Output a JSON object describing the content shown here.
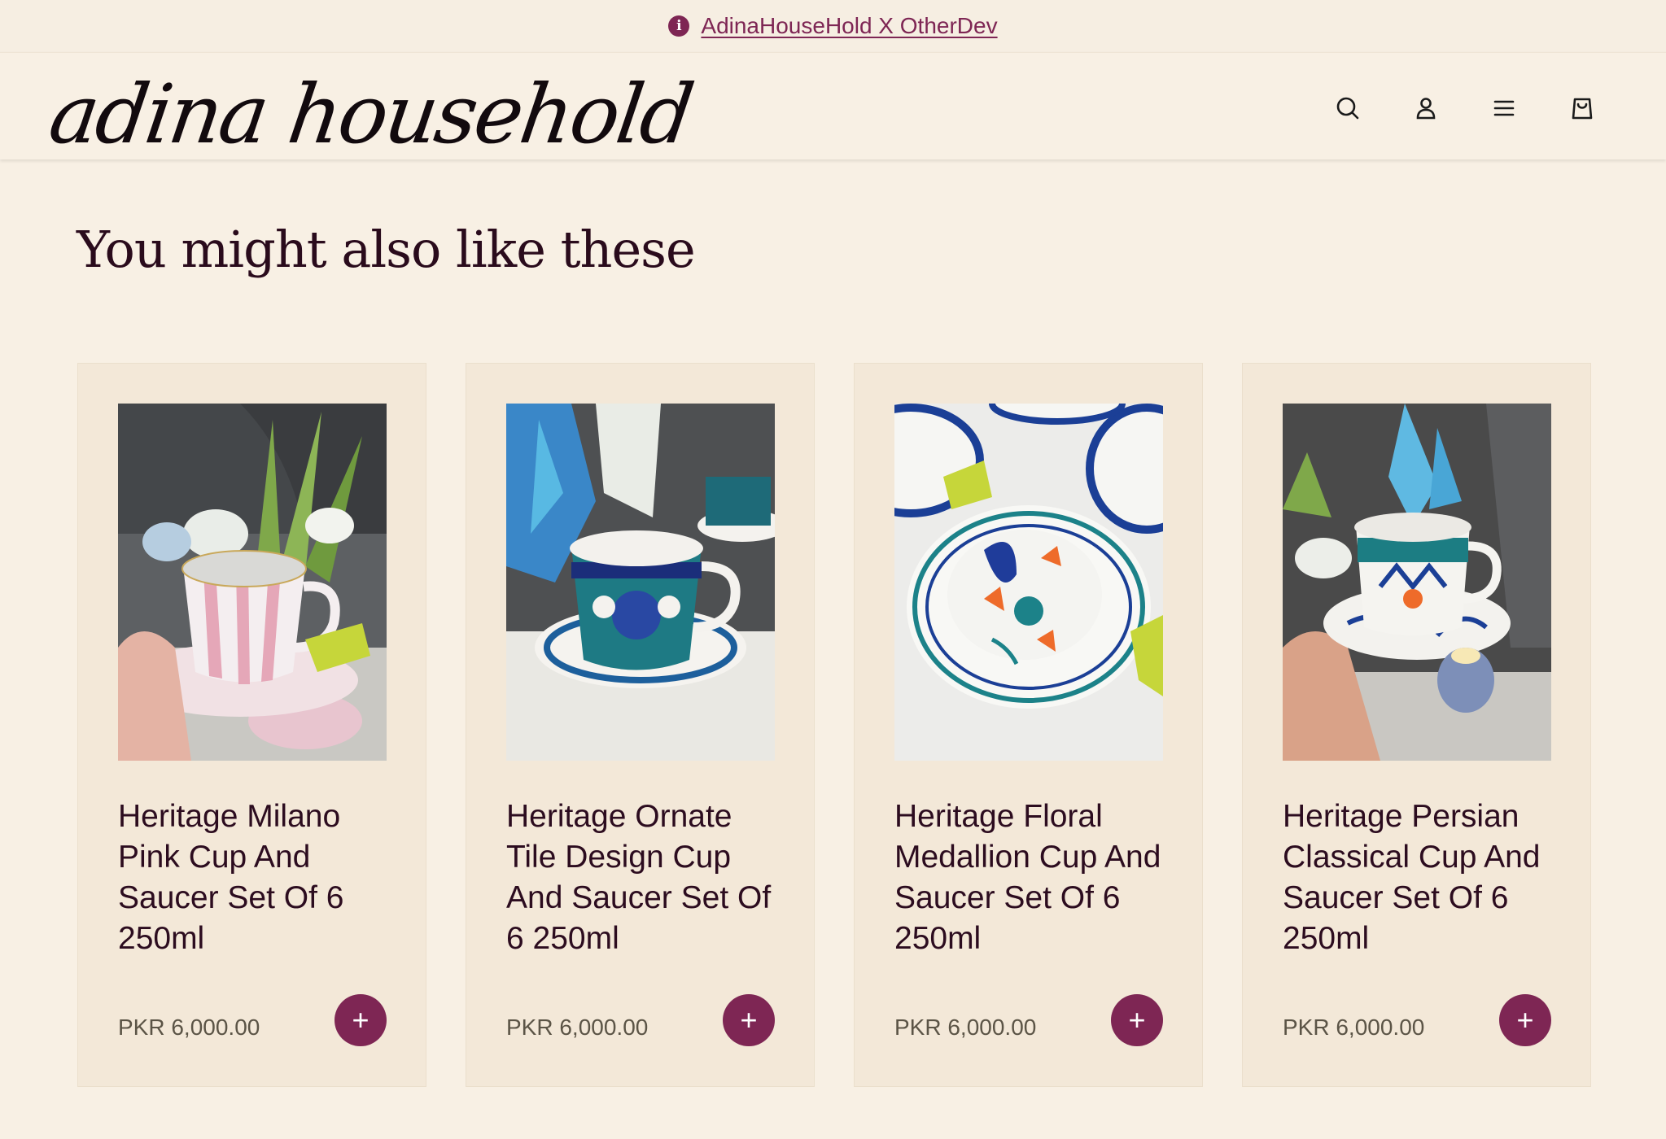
{
  "announcement": {
    "text": "AdinaHouseHold X OtherDev"
  },
  "header": {
    "logo_text": "adina household",
    "icons": [
      "search-icon",
      "account-icon",
      "menu-icon",
      "cart-icon"
    ]
  },
  "section": {
    "title": "You might also like these"
  },
  "products": [
    {
      "title": "Heritage Milano Pink Cup And Saucer Set Of 6 250ml",
      "price": "PKR 6,000.00",
      "add_label": "+"
    },
    {
      "title": "Heritage Ornate Tile Design Cup And Saucer Set Of 6 250ml",
      "price": "PKR 6,000.00",
      "add_label": "+"
    },
    {
      "title": "Heritage Floral Medallion Cup And Saucer Set Of 6 250ml",
      "price": "PKR 6,000.00",
      "add_label": "+"
    },
    {
      "title": "Heritage Persian Classical Cup And Saucer Set Of 6 250ml",
      "price": "PKR 6,000.00",
      "add_label": "+"
    }
  ],
  "colors": {
    "background": "#f8f0e4",
    "card": "#f3e8d8",
    "accent": "#7e2654",
    "text": "#2c0c1f"
  }
}
